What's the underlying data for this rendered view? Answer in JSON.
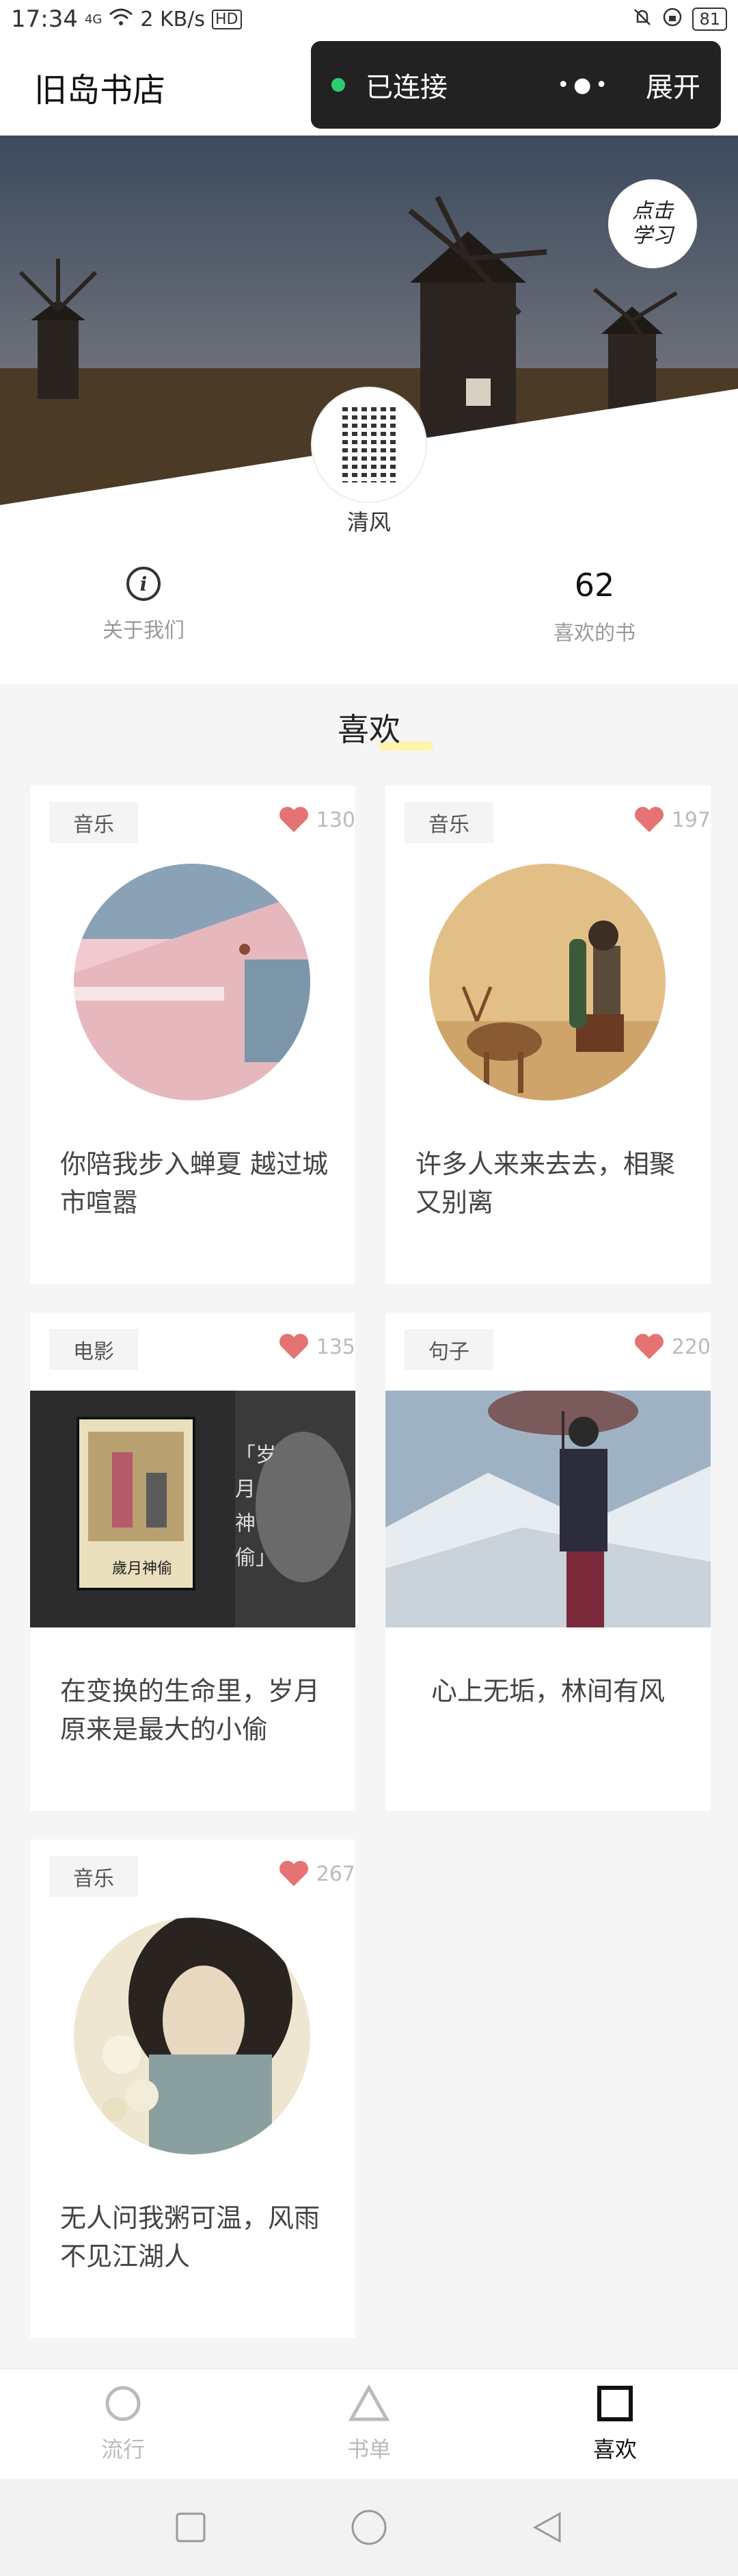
{
  "status": {
    "time": "17:34",
    "network": "4G",
    "speed": "2 KB/s",
    "hd": "HD",
    "battery": "81"
  },
  "nav": {
    "title": "旧岛书店"
  },
  "connection": {
    "label": "已连接",
    "expand": "展开",
    "dot_color": "#2ecc71"
  },
  "hero": {
    "badge_line1": "点击",
    "badge_line2": "学习"
  },
  "profile": {
    "username": "清风",
    "about_label": "关于我们",
    "likes_count": "62",
    "likes_label": "喜欢的书"
  },
  "section": {
    "title": "喜欢"
  },
  "cards": [
    {
      "tag": "音乐",
      "likes": "130",
      "text": "你陪我步入蝉夏 越过城市喧嚣"
    },
    {
      "tag": "音乐",
      "likes": "197",
      "text": "许多人来来去去，相聚又别离"
    },
    {
      "tag": "电影",
      "likes": "135",
      "text": "在变换的生命里，岁月原来是最大的小偷",
      "poster_title": "歲月神偷",
      "overlay_text": "「岁 月 神 偷」"
    },
    {
      "tag": "句子",
      "likes": "220",
      "text": "心上无垢，林间有风"
    },
    {
      "tag": "音乐",
      "likes": "267",
      "text": "无人问我粥可温，风雨不见江湖人"
    }
  ],
  "tabs": [
    {
      "label": "流行",
      "icon": "circle-icon",
      "active": false
    },
    {
      "label": "书单",
      "icon": "triangle-icon",
      "active": false
    },
    {
      "label": "喜欢",
      "icon": "square-icon",
      "active": true
    }
  ],
  "colors": {
    "heart": "#e57373",
    "accent_dark": "#222222"
  }
}
